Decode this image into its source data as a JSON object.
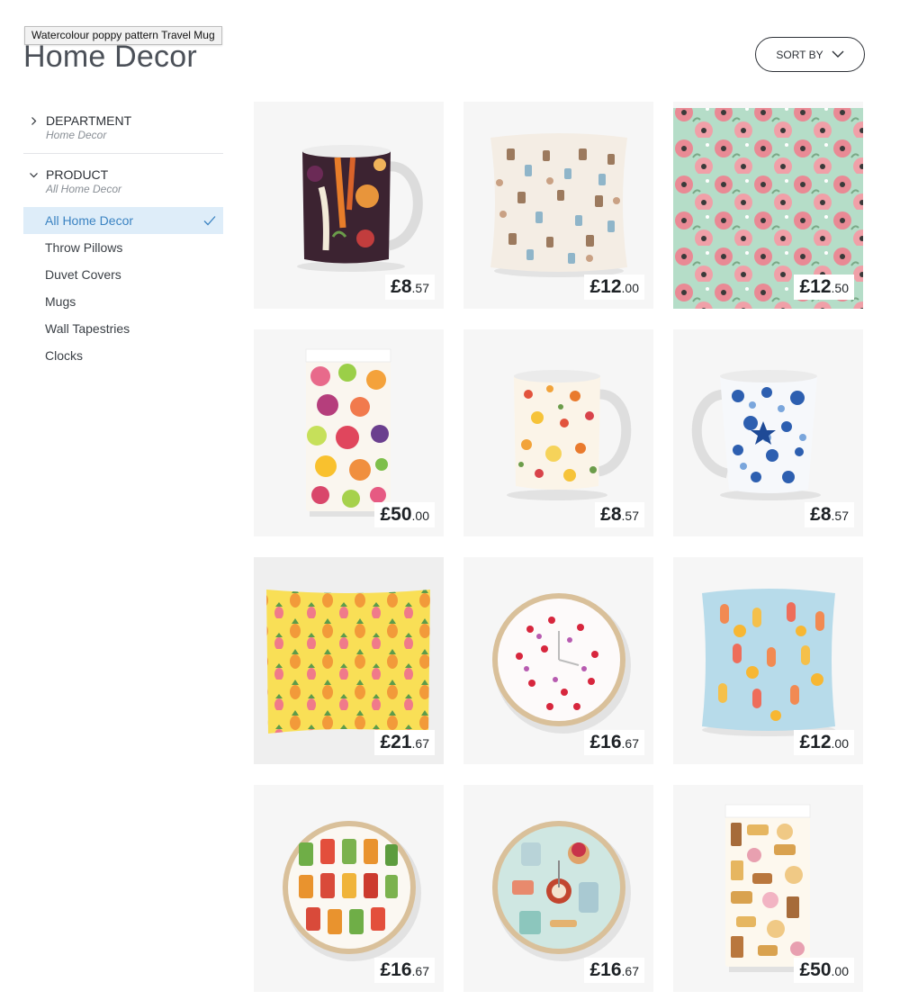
{
  "tooltip": "Watercolour poppy pattern Travel Mug",
  "page": {
    "title": "Home Decor"
  },
  "sort": {
    "label": "SORT BY"
  },
  "filters": {
    "department": {
      "title": "DEPARTMENT",
      "value": "Home Decor"
    },
    "product": {
      "title": "PRODUCT",
      "value": "All Home Decor"
    },
    "items": [
      {
        "label": "All Home Decor",
        "active": true
      },
      {
        "label": "Throw Pillows"
      },
      {
        "label": "Duvet Covers"
      },
      {
        "label": "Mugs"
      },
      {
        "label": "Wall Tapestries"
      },
      {
        "label": "Clocks"
      }
    ]
  },
  "products": [
    {
      "type": "mug",
      "theme": "vegetables",
      "price_main": "£8",
      "price_cents": ".57"
    },
    {
      "type": "pillow",
      "theme": "coffee pots",
      "price_main": "£12",
      "price_cents": ".00"
    },
    {
      "type": "travel-mug",
      "theme": "poppies",
      "price_main": "£12",
      "price_cents": ".50"
    },
    {
      "type": "duvet",
      "theme": "fruit slices",
      "price_main": "£50",
      "price_cents": ".00"
    },
    {
      "type": "mug",
      "theme": "wildflowers",
      "price_main": "£8",
      "price_cents": ".57"
    },
    {
      "type": "tall-mug",
      "theme": "seashells",
      "price_main": "£8",
      "price_cents": ".57"
    },
    {
      "type": "tapestry",
      "theme": "pineapples",
      "price_main": "£21",
      "price_cents": ".67"
    },
    {
      "type": "clock",
      "theme": "cherries",
      "price_main": "£16",
      "price_cents": ".67"
    },
    {
      "type": "pillow",
      "theme": "ice lollies",
      "price_main": "£12",
      "price_cents": ".00"
    },
    {
      "type": "clock",
      "theme": "pickle jars",
      "price_main": "£16",
      "price_cents": ".67"
    },
    {
      "type": "clock",
      "theme": "baking kitchen",
      "price_main": "£16",
      "price_cents": ".67"
    },
    {
      "type": "duvet",
      "theme": "biscuits",
      "price_main": "£50",
      "price_cents": ".00"
    }
  ],
  "colors": {
    "accent": "#3b83c2",
    "active_bg": "#deedf9",
    "card_bg": "#f6f6f6"
  }
}
